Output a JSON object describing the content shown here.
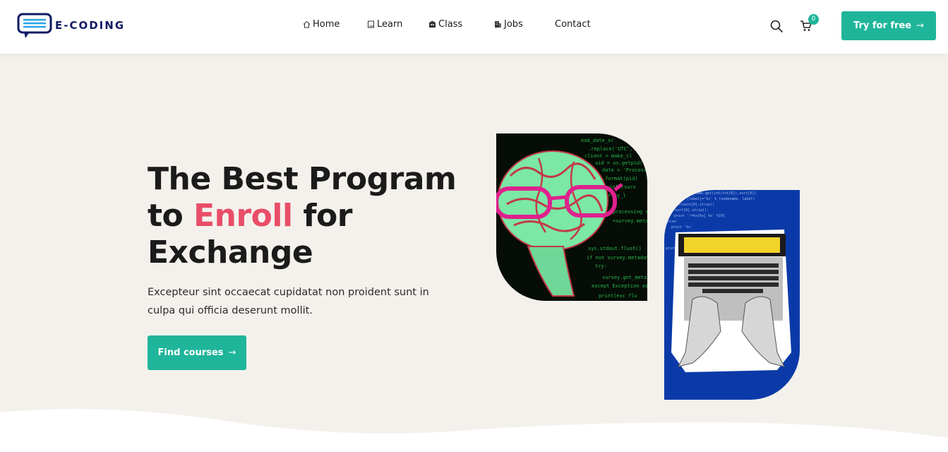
{
  "brand": {
    "name": "E-CODING"
  },
  "nav": {
    "items": [
      {
        "label": "Home",
        "icon": "home-icon"
      },
      {
        "label": "Learn",
        "icon": "book-icon"
      },
      {
        "label": "Class",
        "icon": "school-icon"
      },
      {
        "label": "Jobs",
        "icon": "briefcase-icon"
      },
      {
        "label": "Contact",
        "icon": ""
      }
    ]
  },
  "header": {
    "cart_count": "0",
    "cta_label": "Try for free",
    "cta_arrow": "→"
  },
  "hero": {
    "title_line1": "The Best Program",
    "title_to": "to",
    "title_accent": "Enroll",
    "title_for": "for",
    "title_line3": "Exchange",
    "subtitle": "Excepteur sint occaecat cupidatat non proident sunt in culpa qui officia deserunt mollit.",
    "button_label": "Find courses",
    "button_arrow": "→"
  },
  "colors": {
    "accent": "#1fb59a",
    "highlight": "#e84e68",
    "brand_navy": "#0e1a63",
    "hero_bg": "#f4f1ec",
    "laptop_panel": "#0b3aa8"
  }
}
